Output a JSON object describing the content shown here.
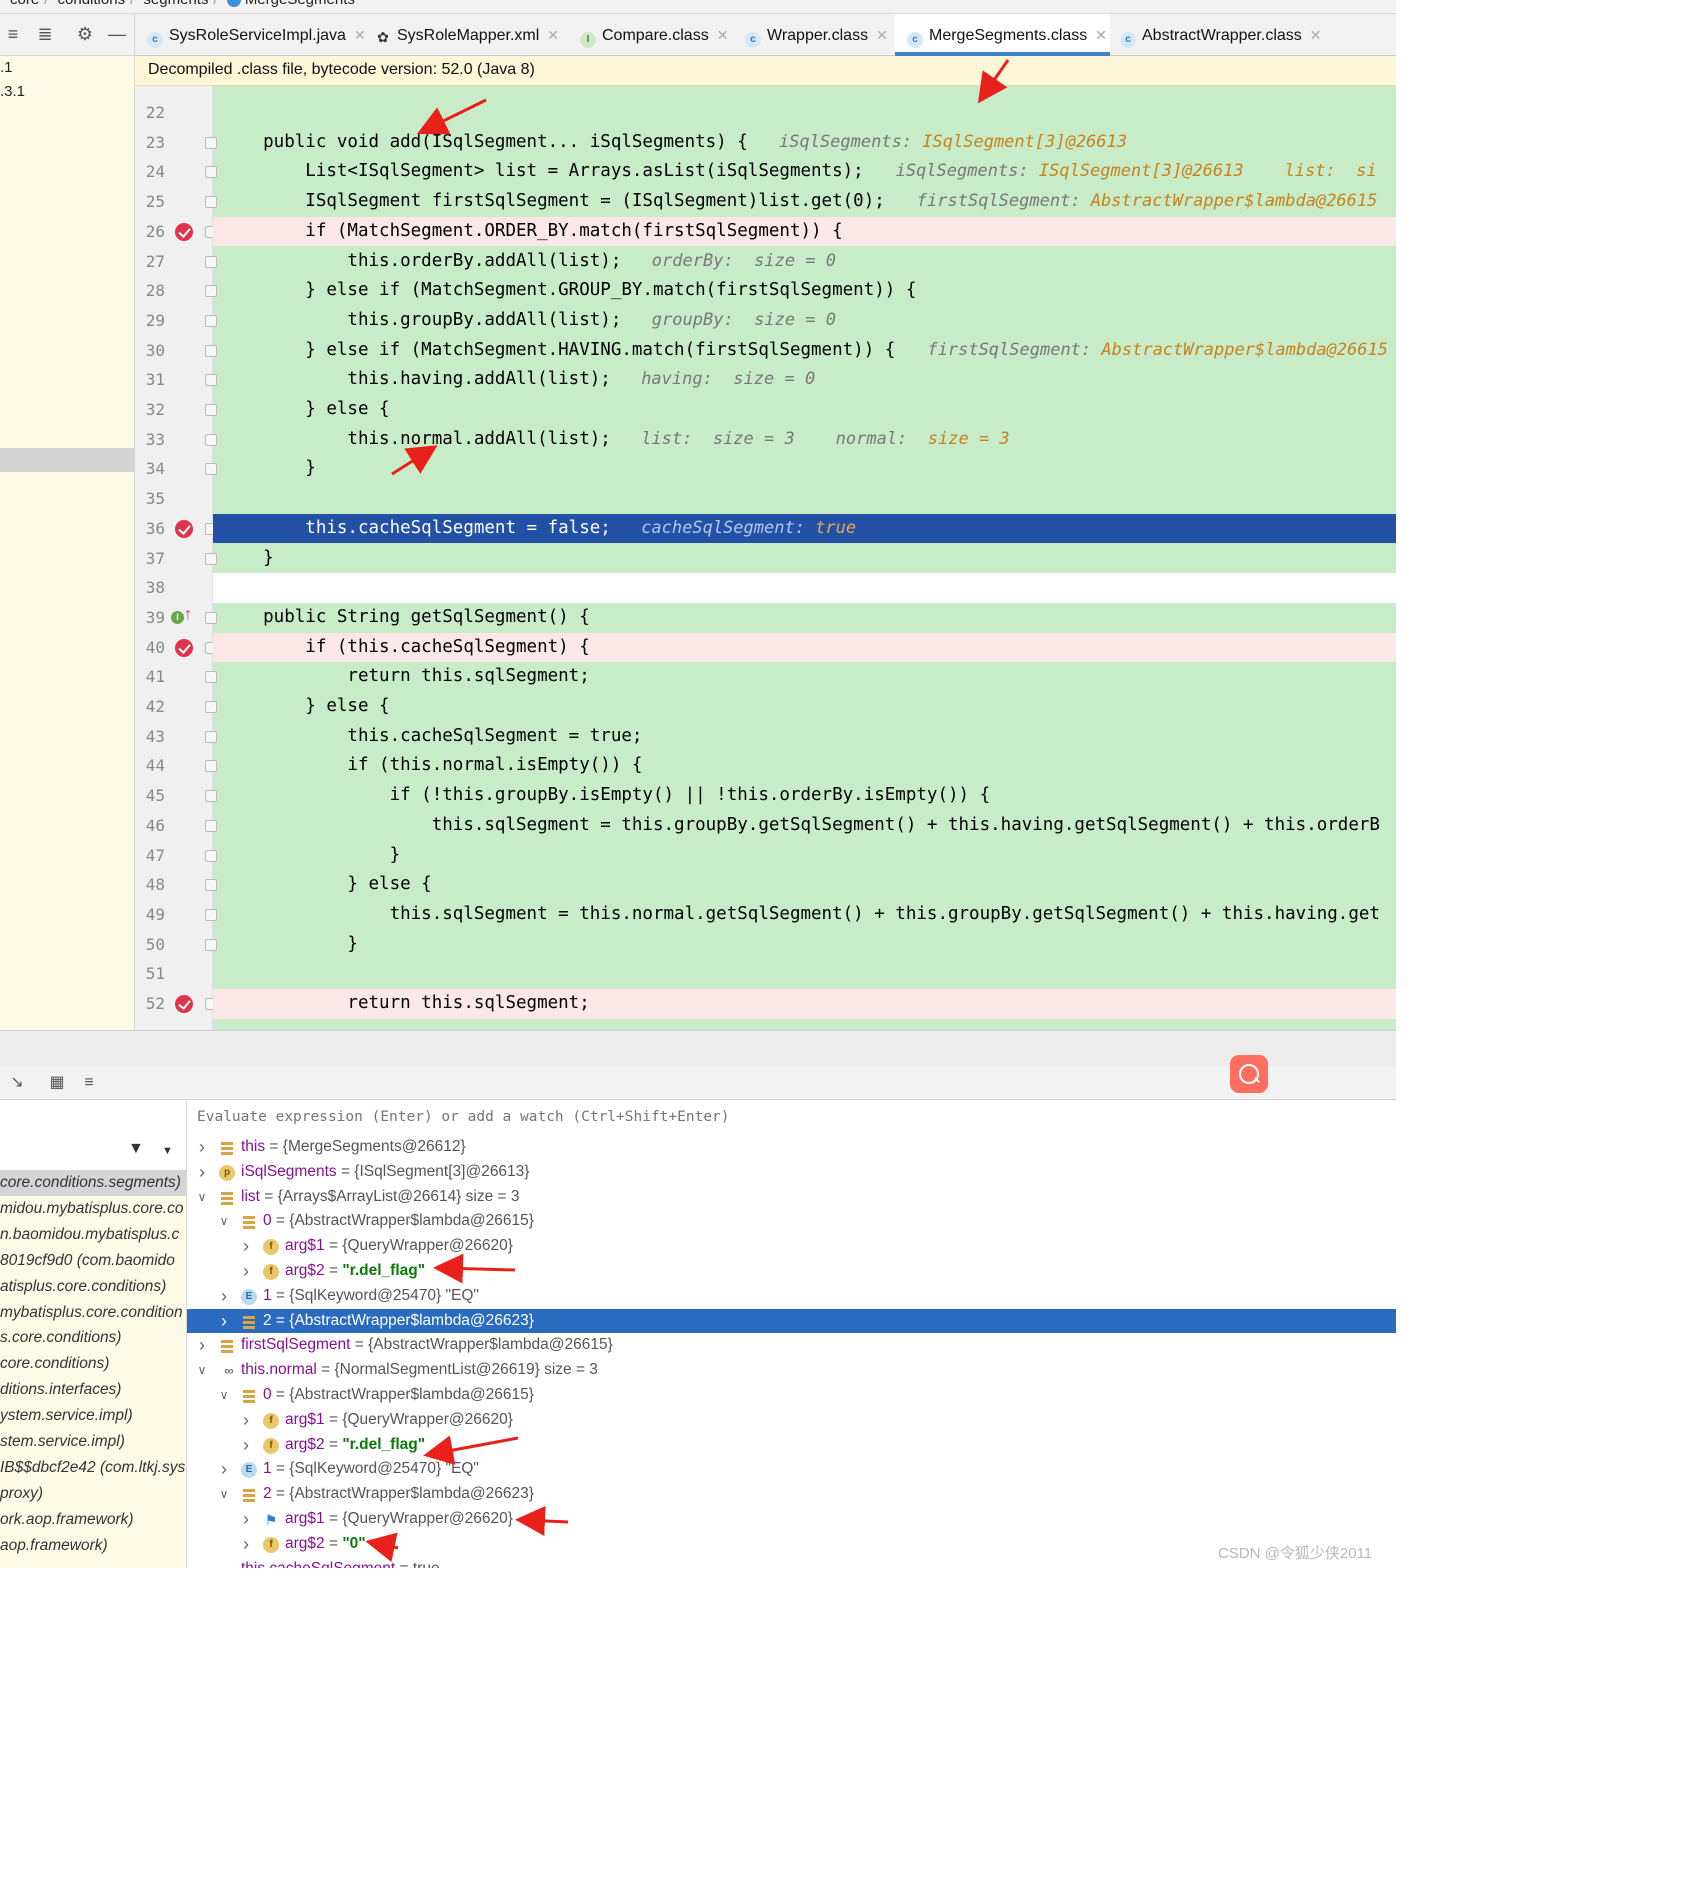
{
  "breadcrumb": [
    "core",
    "conditions",
    "segments",
    "MergeSegments"
  ],
  "left_tree": {
    "rows": [
      ".1",
      ".3.1"
    ]
  },
  "tabs": [
    {
      "label": "SysRoleServiceImpl.java",
      "icon": "class-icon",
      "active": false
    },
    {
      "label": "SysRoleMapper.xml",
      "icon": "mybatis-bird-icon",
      "active": false
    },
    {
      "label": "Compare.class",
      "icon": "interface-icon",
      "active": false
    },
    {
      "label": "Wrapper.class",
      "icon": "abstract-class-icon",
      "active": false
    },
    {
      "label": "MergeSegments.class",
      "icon": "class-icon",
      "active": true
    },
    {
      "label": "AbstractWrapper.class",
      "icon": "abstract-class-icon",
      "active": false
    }
  ],
  "notice": "Decompiled .class file, bytecode version: 52.0 (Java 8)",
  "code_lines": [
    {
      "n": "22",
      "code": "",
      "hint": "",
      "hint_val": "",
      "bg": "green",
      "bp": false
    },
    {
      "n": "23",
      "code": "    public void add(ISqlSegment... iSqlSegments) {",
      "hint": "iSqlSegments: ",
      "hint_val": "ISqlSegment[3]@26613",
      "bg": "green",
      "bp": false
    },
    {
      "n": "24",
      "code": "        List<ISqlSegment> list = Arrays.asList(iSqlSegments);",
      "hint": "iSqlSegments: ",
      "hint_val": "ISqlSegment[3]@26613    list:  si",
      "bg": "green",
      "bp": false
    },
    {
      "n": "25",
      "code": "        ISqlSegment firstSqlSegment = (ISqlSegment)list.get(0);",
      "hint": "firstSqlSegment: ",
      "hint_val": "AbstractWrapper$lambda@26615",
      "bg": "green",
      "bp": false
    },
    {
      "n": "26",
      "code": "        if (MatchSegment.ORDER_BY.match(firstSqlSegment)) {",
      "hint": "",
      "hint_val": "",
      "bg": "pink",
      "bp": true
    },
    {
      "n": "27",
      "code": "            this.orderBy.addAll(list);",
      "hint": "orderBy:  size = 0",
      "hint_val": "",
      "bg": "green",
      "bp": false
    },
    {
      "n": "28",
      "code": "        } else if (MatchSegment.GROUP_BY.match(firstSqlSegment)) {",
      "hint": "",
      "hint_val": "",
      "bg": "green",
      "bp": false
    },
    {
      "n": "29",
      "code": "            this.groupBy.addAll(list);",
      "hint": "groupBy:  size = 0",
      "hint_val": "",
      "bg": "green",
      "bp": false
    },
    {
      "n": "30",
      "code": "        } else if (MatchSegment.HAVING.match(firstSqlSegment)) {",
      "hint": "firstSqlSegment: ",
      "hint_val": "AbstractWrapper$lambda@26615",
      "bg": "green",
      "bp": false
    },
    {
      "n": "31",
      "code": "            this.having.addAll(list);",
      "hint": "having:  size = 0",
      "hint_val": "",
      "bg": "green",
      "bp": false
    },
    {
      "n": "32",
      "code": "        } else {",
      "hint": "",
      "hint_val": "",
      "bg": "green",
      "bp": false
    },
    {
      "n": "33",
      "code": "            this.normal.addAll(list);",
      "hint": "list:  size = 3    normal:  ",
      "hint_val": "size = 3",
      "bg": "green",
      "bp": false
    },
    {
      "n": "34",
      "code": "        }",
      "hint": "",
      "hint_val": "",
      "bg": "green",
      "bp": false
    },
    {
      "n": "35",
      "code": "",
      "hint": "",
      "hint_val": "",
      "bg": "green",
      "bp": false
    },
    {
      "n": "36",
      "code": "        this.cacheSqlSegment = false;",
      "hint": "cacheSqlSegment: ",
      "hint_val": "true",
      "bg": "blue",
      "bp": true
    },
    {
      "n": "37",
      "code": "    }",
      "hint": "",
      "hint_val": "",
      "bg": "green",
      "bp": false
    },
    {
      "n": "38",
      "code": "",
      "hint": "",
      "hint_val": "",
      "bg": "white",
      "bp": false
    },
    {
      "n": "39",
      "code": "    public String getSqlSegment() {",
      "hint": "",
      "hint_val": "",
      "bg": "green",
      "bp": false
    },
    {
      "n": "40",
      "code": "        if (this.cacheSqlSegment) {",
      "hint": "",
      "hint_val": "",
      "bg": "pink",
      "bp": true
    },
    {
      "n": "41",
      "code": "            return this.sqlSegment;",
      "hint": "",
      "hint_val": "",
      "bg": "green",
      "bp": false
    },
    {
      "n": "42",
      "code": "        } else {",
      "hint": "",
      "hint_val": "",
      "bg": "green",
      "bp": false
    },
    {
      "n": "43",
      "code": "            this.cacheSqlSegment = true;",
      "hint": "",
      "hint_val": "",
      "bg": "green",
      "bp": false
    },
    {
      "n": "44",
      "code": "            if (this.normal.isEmpty()) {",
      "hint": "",
      "hint_val": "",
      "bg": "green",
      "bp": false
    },
    {
      "n": "45",
      "code": "                if (!this.groupBy.isEmpty() || !this.orderBy.isEmpty()) {",
      "hint": "",
      "hint_val": "",
      "bg": "green",
      "bp": false
    },
    {
      "n": "46",
      "code": "                    this.sqlSegment = this.groupBy.getSqlSegment() + this.having.getSqlSegment() + this.orderB",
      "hint": "",
      "hint_val": "",
      "bg": "green",
      "bp": false
    },
    {
      "n": "47",
      "code": "                }",
      "hint": "",
      "hint_val": "",
      "bg": "green",
      "bp": false
    },
    {
      "n": "48",
      "code": "            } else {",
      "hint": "",
      "hint_val": "",
      "bg": "green",
      "bp": false
    },
    {
      "n": "49",
      "code": "                this.sqlSegment = this.normal.getSqlSegment() + this.groupBy.getSqlSegment() + this.having.get",
      "hint": "",
      "hint_val": "",
      "bg": "green",
      "bp": false
    },
    {
      "n": "50",
      "code": "            }",
      "hint": "",
      "hint_val": "",
      "bg": "green",
      "bp": false
    },
    {
      "n": "51",
      "code": "",
      "hint": "",
      "hint_val": "",
      "bg": "green",
      "bp": false
    },
    {
      "n": "52",
      "code": "            return this.sqlSegment;",
      "hint": "",
      "hint_val": "",
      "bg": "pink",
      "bp": true
    }
  ],
  "watch_placeholder": "Evaluate expression (Enter) or add a watch (Ctrl+Shift+Enter)",
  "frames": [
    "core.conditions.segments)",
    "midou.mybatisplus.core.co",
    "n.baomidou.mybatisplus.c",
    "8019cf9d0 (com.baomido",
    "atisplus.core.conditions)",
    "mybatisplus.core.condition",
    "s.core.conditions)",
    "core.conditions)",
    "ditions.interfaces)",
    "ystem.service.impl)",
    "stem.service.impl)",
    "IB$$dbcf2e42 (com.ltkj.sys",
    "proxy)",
    "ork.aop.framework)",
    "aop.framework)"
  ],
  "variables": [
    {
      "indent": 0,
      "expand": "right",
      "icon": "list",
      "name": "this",
      "value": " = {MergeSegments@26612}",
      "str": ""
    },
    {
      "indent": 0,
      "expand": "right",
      "icon": "param",
      "name": "iSqlSegments",
      "value": " = {ISqlSegment[3]@26613}",
      "str": ""
    },
    {
      "indent": 0,
      "expand": "down",
      "icon": "list",
      "name": "list",
      "value": " = {Arrays$ArrayList@26614}  size = 3",
      "str": ""
    },
    {
      "indent": 1,
      "expand": "down",
      "icon": "list",
      "name": "0",
      "value": " = {AbstractWrapper$lambda@26615}",
      "str": ""
    },
    {
      "indent": 2,
      "expand": "right",
      "icon": "field",
      "name": "arg$1",
      "value": " = {QueryWrapper@26620}",
      "str": ""
    },
    {
      "indent": 2,
      "expand": "right",
      "icon": "field",
      "name": "arg$2",
      "value": " = ",
      "str": "\"r.del_flag\""
    },
    {
      "indent": 1,
      "expand": "right",
      "icon": "enum",
      "name": "1",
      "value": " = {SqlKeyword@25470} \"EQ\"",
      "str": ""
    },
    {
      "indent": 1,
      "expand": "right",
      "icon": "list",
      "name": "2",
      "value": " = {AbstractWrapper$lambda@26623}",
      "str": "",
      "selected": true
    },
    {
      "indent": 0,
      "expand": "right",
      "icon": "list",
      "name": "firstSqlSegment",
      "value": " = {AbstractWrapper$lambda@26615}",
      "str": ""
    },
    {
      "indent": 0,
      "expand": "down",
      "icon": "watch",
      "name": "this.normal",
      "value": " = {NormalSegmentList@26619}  size = 3",
      "str": ""
    },
    {
      "indent": 1,
      "expand": "down",
      "icon": "list",
      "name": "0",
      "value": " = {AbstractWrapper$lambda@26615}",
      "str": ""
    },
    {
      "indent": 2,
      "expand": "right",
      "icon": "field",
      "name": "arg$1",
      "value": " = {QueryWrapper@26620}",
      "str": ""
    },
    {
      "indent": 2,
      "expand": "right",
      "icon": "field",
      "name": "arg$2",
      "value": " = ",
      "str": "\"r.del_flag\""
    },
    {
      "indent": 1,
      "expand": "right",
      "icon": "enum",
      "name": "1",
      "value": " = {SqlKeyword@25470} \"EQ\"",
      "str": ""
    },
    {
      "indent": 1,
      "expand": "down",
      "icon": "list",
      "name": "2",
      "value": " = {AbstractWrapper$lambda@26623}",
      "str": ""
    },
    {
      "indent": 2,
      "expand": "right",
      "icon": "flag",
      "name": "arg$1",
      "value": " = {QueryWrapper@26620}",
      "str": ""
    },
    {
      "indent": 2,
      "expand": "right",
      "icon": "field",
      "name": "arg$2",
      "value": " = ",
      "str": "\"0\""
    },
    {
      "indent": 0,
      "expand": "",
      "icon": "watch",
      "name": "this.cacheSqlSegment",
      "value": " = true",
      "str": ""
    }
  ],
  "watermark": "CSDN @令狐少侠2011"
}
